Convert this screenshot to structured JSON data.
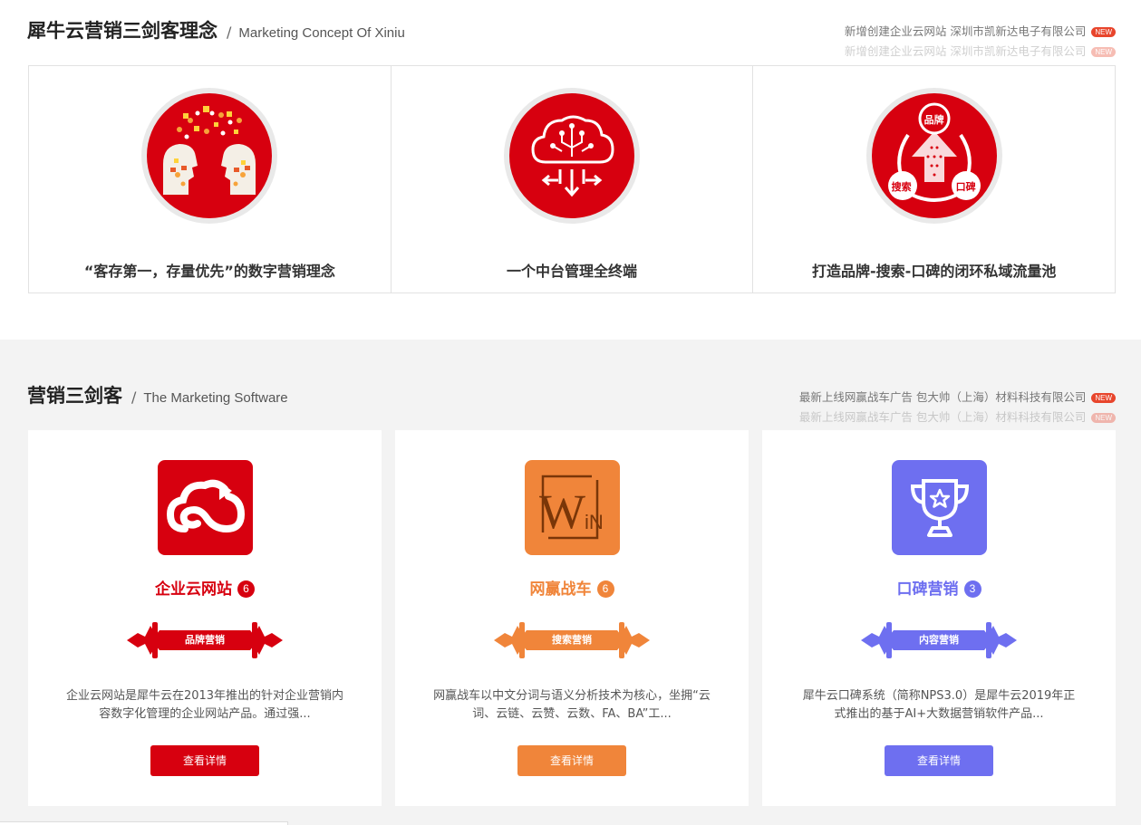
{
  "concept_section": {
    "title_zh": "犀牛云营销三剑客理念",
    "separator": "/",
    "title_en": "Marketing Concept Of Xiniu",
    "news": [
      {
        "text": "新增创建企业云网站 深圳市凯新达电子有限公司",
        "tag": "NEW"
      },
      {
        "text": "新增创建企业云网站 深圳市凯新达电子有限公司",
        "tag": "NEW"
      }
    ],
    "items": [
      {
        "caption": "“客存第一，存量优先”的数字营销理念",
        "icon": "heads-exchange-icon"
      },
      {
        "caption": "一个中台管理全终端",
        "icon": "cloud-terminal-icon"
      },
      {
        "caption": "打造品牌-搜索-口碑的闭环私域流量池",
        "icon": "loop-pool-icon",
        "labels": {
          "top": "品牌",
          "left": "搜索",
          "right": "口碑"
        }
      }
    ]
  },
  "software_section": {
    "title_zh": "营销三剑客",
    "separator": "/",
    "title_en": "The Marketing Software",
    "news": [
      {
        "text": "最新上线网赢战车广告 包大帅（上海）材料科技有限公司",
        "tag": "NEW"
      },
      {
        "text": "最新上线网赢战车广告 包大帅（上海）材料科技有限公司",
        "tag": "NEW"
      }
    ],
    "cards": [
      {
        "name": "企业云网站",
        "count": "6",
        "banner": "品牌营销",
        "desc": "企业云网站是犀牛云在2013年推出的针对企业营销内容数字化管理的企业网站产品。通过强...",
        "button": "查看详情",
        "color": "#d7000f",
        "icon": "cloud-icon"
      },
      {
        "name": "网赢战车",
        "count": "6",
        "banner": "搜索营销",
        "desc": "网赢战车以中文分词与语义分析技术为核心，坐拥“云词、云链、云赞、云数、FA、BA”工...",
        "button": "查看详情",
        "color": "#f0853a",
        "icon": "win-icon",
        "logo_text": "W",
        "logo_text_small": "iN"
      },
      {
        "name": "口碑营销",
        "count": "3",
        "banner": "内容营销",
        "desc": "犀牛云口碑系统（简称NPS3.0）是犀牛云2019年正式推出的基于AI+大数据营销软件产品...",
        "button": "查看详情",
        "color": "#6e6ff0",
        "icon": "trophy-icon"
      }
    ]
  }
}
